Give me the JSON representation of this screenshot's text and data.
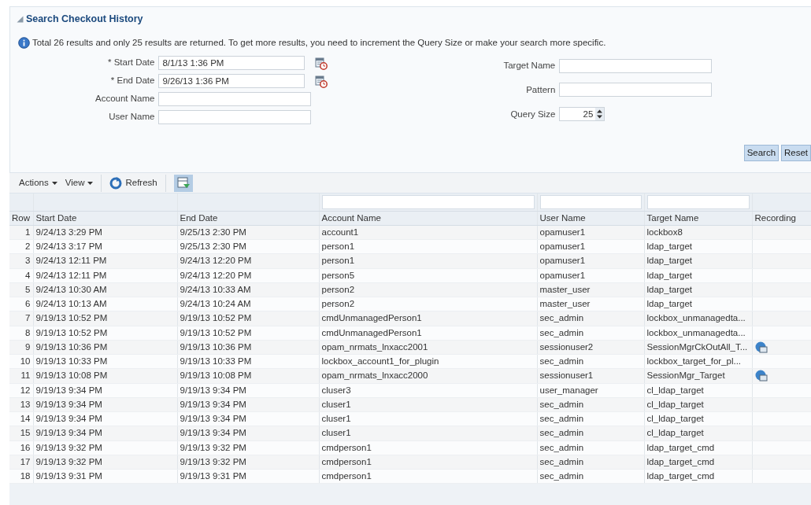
{
  "panel": {
    "title": "Search Checkout History",
    "expanded": true,
    "info": "Total 26 results and only 25 results are returned. To get more results, you need to increment the Query Size or make your search more specific.",
    "left_fields": [
      {
        "label": "* Start Date",
        "value": "8/1/13 1:36 PM",
        "kind": "date"
      },
      {
        "label": "* End Date",
        "value": "9/26/13 1:36 PM",
        "kind": "date"
      },
      {
        "label": "Account Name",
        "kind": "text"
      },
      {
        "label": "User Name",
        "kind": "text"
      }
    ],
    "right_fields": [
      {
        "label": "Target Name",
        "kind": "text"
      },
      {
        "label": "Pattern",
        "kind": "text"
      },
      {
        "label": "Query Size",
        "value": "25",
        "kind": "spinner"
      }
    ],
    "buttons": [
      "Search",
      "Reset"
    ]
  },
  "toolbar": {
    "menus": [
      "Actions",
      "View"
    ],
    "refresh": "Refresh"
  },
  "table": {
    "columns": [
      {
        "label": "Row",
        "filter": false
      },
      {
        "label": "Start Date",
        "filter": false
      },
      {
        "label": "End Date",
        "filter": false
      },
      {
        "label": "Account Name",
        "filter": true
      },
      {
        "label": "User Name",
        "filter": true
      },
      {
        "label": "Target Name",
        "filter": true
      },
      {
        "label": "Recording",
        "filter": false
      }
    ],
    "rows": [
      {
        "row": "1",
        "start": "9/24/13 3:29 PM",
        "end": "9/25/13 2:30 PM",
        "account": "account1",
        "user": "opamuser1",
        "target": "lockbox8",
        "recording": false
      },
      {
        "row": "2",
        "start": "9/24/13 3:17 PM",
        "end": "9/25/13 2:30 PM",
        "account": "person1",
        "user": "opamuser1",
        "target": "ldap_target",
        "recording": false
      },
      {
        "row": "3",
        "start": "9/24/13 12:11 PM",
        "end": "9/24/13 12:20 PM",
        "account": "person1",
        "user": "opamuser1",
        "target": "ldap_target",
        "recording": false
      },
      {
        "row": "4",
        "start": "9/24/13 12:11 PM",
        "end": "9/24/13 12:20 PM",
        "account": "person5",
        "user": "opamuser1",
        "target": "ldap_target",
        "recording": false
      },
      {
        "row": "5",
        "start": "9/24/13 10:30 AM",
        "end": "9/24/13 10:33 AM",
        "account": "person2",
        "user": "master_user",
        "target": "ldap_target",
        "recording": false
      },
      {
        "row": "6",
        "start": "9/24/13 10:13 AM",
        "end": "9/24/13 10:24 AM",
        "account": "person2",
        "user": "master_user",
        "target": "ldap_target",
        "recording": false
      },
      {
        "row": "7",
        "start": "9/19/13 10:52 PM",
        "end": "9/19/13 10:52 PM",
        "account": "cmdUnmanagedPerson1",
        "user": "sec_admin",
        "target": "lockbox_unmanagedta...",
        "recording": false
      },
      {
        "row": "8",
        "start": "9/19/13 10:52 PM",
        "end": "9/19/13 10:52 PM",
        "account": "cmdUnmanagedPerson1",
        "user": "sec_admin",
        "target": "lockbox_unmanagedta...",
        "recording": false
      },
      {
        "row": "9",
        "start": "9/19/13 10:36 PM",
        "end": "9/19/13 10:36 PM",
        "account": "opam_nrmats_lnxacc2001",
        "user": "sessionuser2",
        "target": "SessionMgrCkOutAll_T...",
        "recording": true
      },
      {
        "row": "10",
        "start": "9/19/13 10:33 PM",
        "end": "9/19/13 10:33 PM",
        "account": "lockbox_account1_for_plugin",
        "user": "sec_admin",
        "target": "lockbox_target_for_pl...",
        "recording": false
      },
      {
        "row": "11",
        "start": "9/19/13 10:08 PM",
        "end": "9/19/13 10:08 PM",
        "account": "opam_nrmats_lnxacc2000",
        "user": "sessionuser1",
        "target": "SessionMgr_Target",
        "recording": true
      },
      {
        "row": "12",
        "start": "9/19/13 9:34 PM",
        "end": "9/19/13 9:34 PM",
        "account": "cluser3",
        "user": "user_manager",
        "target": "cl_ldap_target",
        "recording": false
      },
      {
        "row": "13",
        "start": "9/19/13 9:34 PM",
        "end": "9/19/13 9:34 PM",
        "account": "cluser1",
        "user": "sec_admin",
        "target": "cl_ldap_target",
        "recording": false
      },
      {
        "row": "14",
        "start": "9/19/13 9:34 PM",
        "end": "9/19/13 9:34 PM",
        "account": "cluser1",
        "user": "sec_admin",
        "target": "cl_ldap_target",
        "recording": false
      },
      {
        "row": "15",
        "start": "9/19/13 9:34 PM",
        "end": "9/19/13 9:34 PM",
        "account": "cluser1",
        "user": "sec_admin",
        "target": "cl_ldap_target",
        "recording": false
      },
      {
        "row": "16",
        "start": "9/19/13 9:32 PM",
        "end": "9/19/13 9:32 PM",
        "account": "cmdperson1",
        "user": "sec_admin",
        "target": "ldap_target_cmd",
        "recording": false
      },
      {
        "row": "17",
        "start": "9/19/13 9:32 PM",
        "end": "9/19/13 9:32 PM",
        "account": "cmdperson1",
        "user": "sec_admin",
        "target": "ldap_target_cmd",
        "recording": false
      },
      {
        "row": "18",
        "start": "9/19/13 9:31 PM",
        "end": "9/19/13 9:31 PM",
        "account": "cmdperson1",
        "user": "sec_admin",
        "target": "ldap_target_cmd",
        "recording": false
      }
    ]
  }
}
